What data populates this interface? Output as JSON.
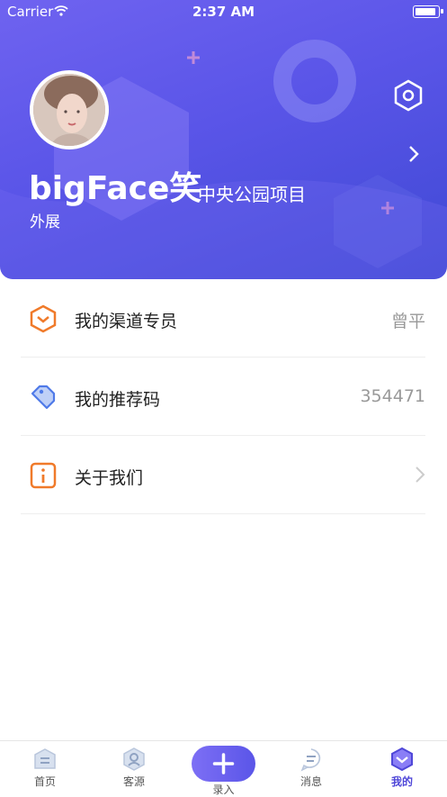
{
  "status_bar": {
    "carrier": "Carrier",
    "time": "2:37 AM"
  },
  "profile": {
    "name": "bigFace笑",
    "project": "中央公园项目",
    "role": "外展"
  },
  "menu": [
    {
      "label": "我的渠道专员",
      "value": "曾平",
      "icon": "hexagon-icon"
    },
    {
      "label": "我的推荐码",
      "value": "354471",
      "icon": "tag-icon"
    },
    {
      "label": "关于我们",
      "value": "",
      "icon": "info-icon"
    }
  ],
  "tabs": {
    "home": "首页",
    "customers": "客源",
    "add": "录入",
    "messages": "消息",
    "mine": "我的"
  },
  "colors": {
    "header_start": "#6f63f0",
    "header_end": "#3f49d4",
    "accent": "#4f47d8",
    "icon_orange": "#f07a2a",
    "icon_blue": "#4f7ae8"
  }
}
